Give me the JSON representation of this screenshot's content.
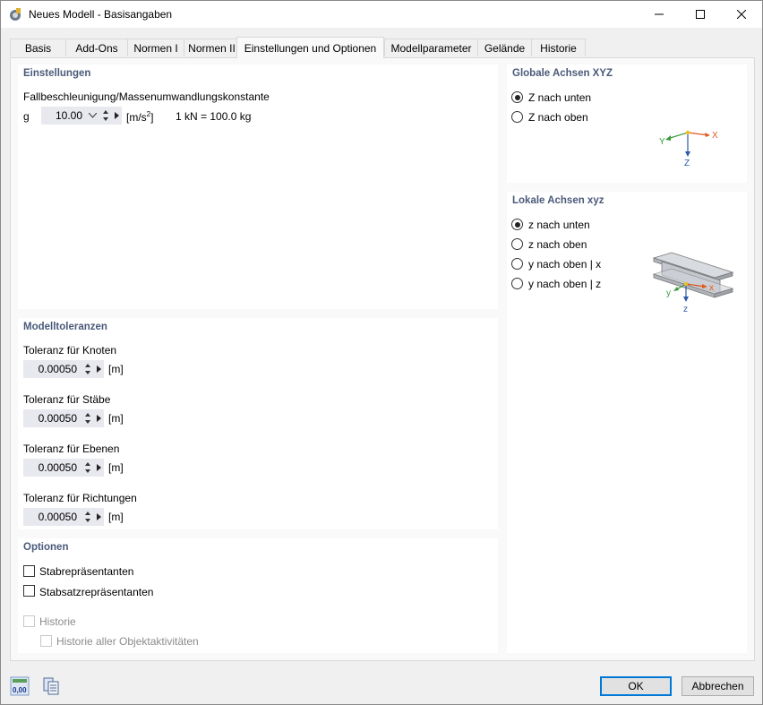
{
  "window": {
    "title": "Neues Modell - Basisangaben",
    "minimize_glyph": "—",
    "maximize_glyph": "☐",
    "close_glyph": "✕"
  },
  "tabs": [
    {
      "label": "Basis"
    },
    {
      "label": "Add-Ons"
    },
    {
      "label": "Normen I"
    },
    {
      "label": "Normen II"
    },
    {
      "label": "Einstellungen und Optionen"
    },
    {
      "label": "Modellparameter"
    },
    {
      "label": "Gelände"
    },
    {
      "label": "Historie"
    }
  ],
  "active_tab": "Einstellungen und Optionen",
  "einstellungen": {
    "title": "Einstellungen",
    "gravity_label": "Fallbeschleunigung/Massenumwandlungskonstante",
    "g_symbol": "g",
    "g_value": "10.00",
    "g_unit_base": "[m/s",
    "g_unit_exp": "2",
    "g_unit_close": "]",
    "conversion": "1 kN = 100.0 kg"
  },
  "modelltoleranzen": {
    "title": "Modelltoleranzen",
    "items": [
      {
        "label": "Toleranz für Knoten",
        "value": "0.00050",
        "unit": "[m]"
      },
      {
        "label": "Toleranz für Stäbe",
        "value": "0.00050",
        "unit": "[m]"
      },
      {
        "label": "Toleranz für Ebenen",
        "value": "0.00050",
        "unit": "[m]"
      },
      {
        "label": "Toleranz für Richtungen",
        "value": "0.00050",
        "unit": "[m]"
      }
    ]
  },
  "optionen": {
    "title": "Optionen",
    "stabrep": "Stabrepräsentanten",
    "stabsatzrep": "Stabsatzrepräsentanten",
    "historie": "Historie",
    "historie_alle": "Historie aller Objektaktivitäten"
  },
  "globale_achsen": {
    "title": "Globale Achsen XYZ",
    "options": [
      "Z nach unten",
      "Z nach oben"
    ],
    "selected": 0,
    "axis_x": "X",
    "axis_y": "Y",
    "axis_z": "Z"
  },
  "lokale_achsen": {
    "title": "Lokale Achsen xyz",
    "options": [
      "z nach unten",
      "z nach oben",
      "y nach oben | x",
      "y nach oben | z"
    ],
    "selected": 0,
    "axis_x": "x",
    "axis_y": "y",
    "axis_z": "z"
  },
  "buttons": {
    "ok": "OK",
    "cancel": "Abbrechen"
  },
  "toolbar": {
    "units_icon_text": "0,00"
  },
  "colors": {
    "accent": "#0078d7",
    "panel_title": "#4a5a7a",
    "axis_x": "#e05a1e",
    "axis_y": "#3a9a3a",
    "axis_z": "#2a5aa8"
  }
}
